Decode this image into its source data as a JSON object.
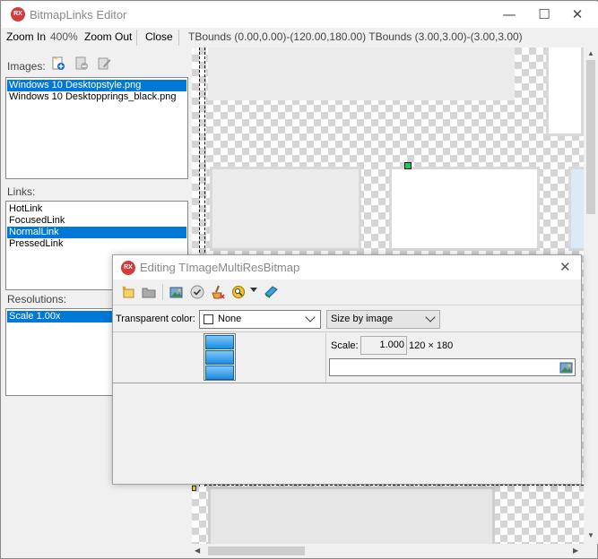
{
  "window": {
    "title": "BitmapLinks Editor",
    "icon_text": "RX",
    "minimize": "—",
    "maximize": "☐",
    "close": "✕"
  },
  "toolbar": {
    "zoom_in": "Zoom In",
    "zoom_level": "400%",
    "zoom_out": "Zoom Out",
    "close": "Close",
    "bounds": "TBounds (0.00,0.00)-(120.00,180.00) TBounds (3.00,3.00)-(3.00,3.00)"
  },
  "images": {
    "label": "Images:",
    "items": [
      "Windows 10 Desktopstyle.png",
      "Windows 10 Desktopprings_black.png"
    ],
    "selected": 0
  },
  "links": {
    "label": "Links:",
    "items": [
      "HotLink",
      "FocusedLink",
      "NormalLink",
      "PressedLink"
    ],
    "selected": 2
  },
  "resolutions": {
    "label": "Resolutions:",
    "items": [
      "Scale 1.00x"
    ],
    "selected": 0
  },
  "dialog": {
    "title": "Editing TImageMultiResBitmap",
    "icon_text": "RX",
    "close": "✕",
    "transparent_label": "Transparent color:",
    "transparent_value": "None",
    "size_mode": "Size by image",
    "scale_label": "Scale:",
    "scale_value": "1.000",
    "dimensions": "120 × 180",
    "filename_value": ""
  },
  "colors": {
    "accent": "#0078d7",
    "handle": "#22c55e",
    "brand_icon": "#d23c3c"
  }
}
